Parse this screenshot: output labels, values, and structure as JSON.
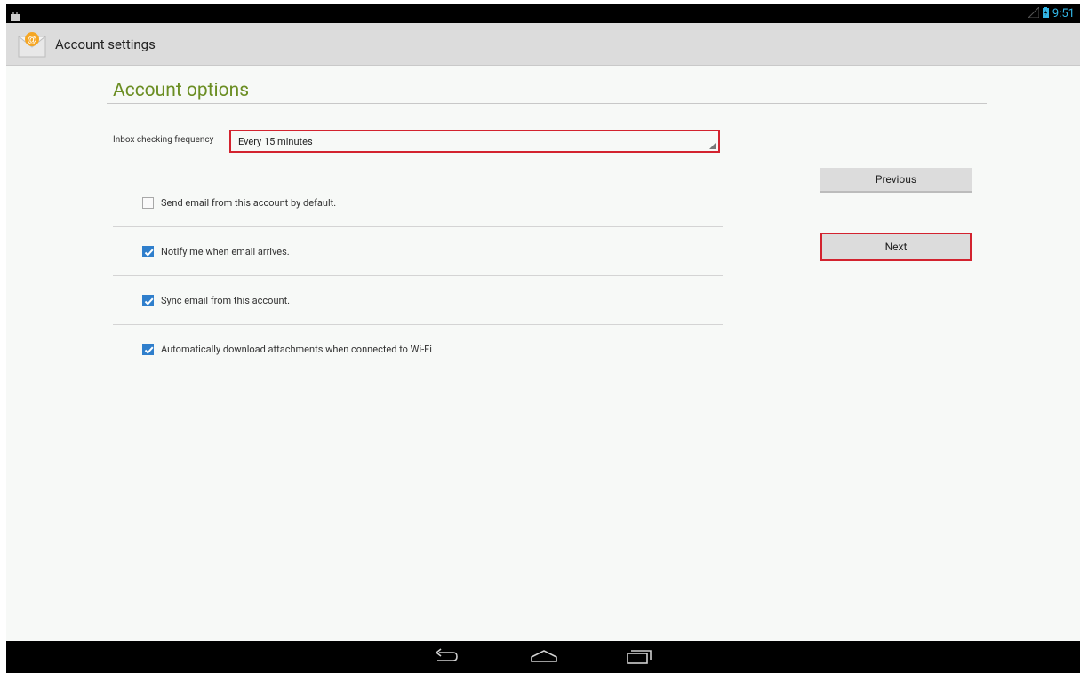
{
  "status_bar": {
    "time": "9:51",
    "colors": {
      "accent": "#33b5e5"
    }
  },
  "action_bar": {
    "title": "Account settings",
    "icon": "email-app-icon"
  },
  "section": {
    "title": "Account options"
  },
  "frequency": {
    "label": "Inbox checking frequency",
    "value": "Every 15 minutes"
  },
  "options": [
    {
      "label": "Send email from this account by default.",
      "checked": false
    },
    {
      "label": "Notify me when email arrives.",
      "checked": true
    },
    {
      "label": "Sync email from this account.",
      "checked": true
    },
    {
      "label": "Automatically download attachments when connected to Wi-Fi",
      "checked": true
    }
  ],
  "buttons": {
    "previous": "Previous",
    "next": "Next"
  },
  "nav": {
    "back": "back-icon",
    "home": "home-icon",
    "recents": "recents-icon"
  },
  "colors": {
    "section_title": "#6b8e23",
    "highlight": "#d3232f",
    "checkbox": "#2f7fcc"
  }
}
